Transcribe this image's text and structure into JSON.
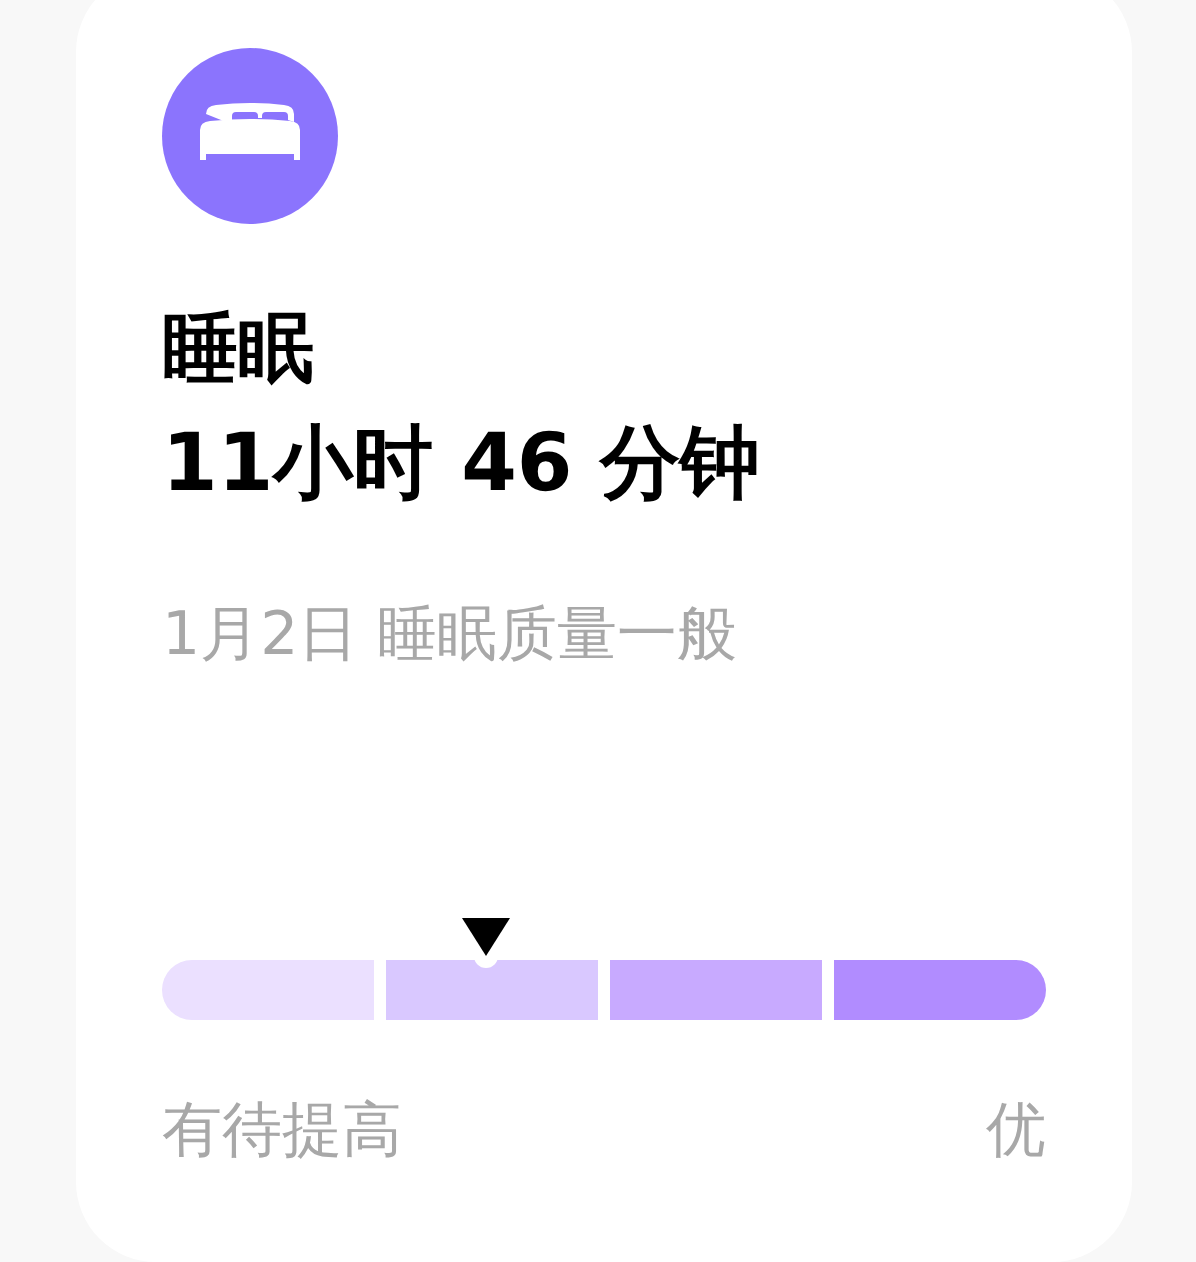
{
  "card": {
    "title": "睡眠",
    "duration": "11小时 46 分钟",
    "summary": "1月2日 睡眠质量一般",
    "scale": {
      "level": 0.367,
      "segments": [
        {
          "color": "#ebe0ff"
        },
        {
          "color": "#d9c8ff"
        },
        {
          "color": "#c8aaff"
        },
        {
          "color": "#b18cff"
        }
      ],
      "low_label": "有待提高",
      "high_label": "优"
    }
  }
}
